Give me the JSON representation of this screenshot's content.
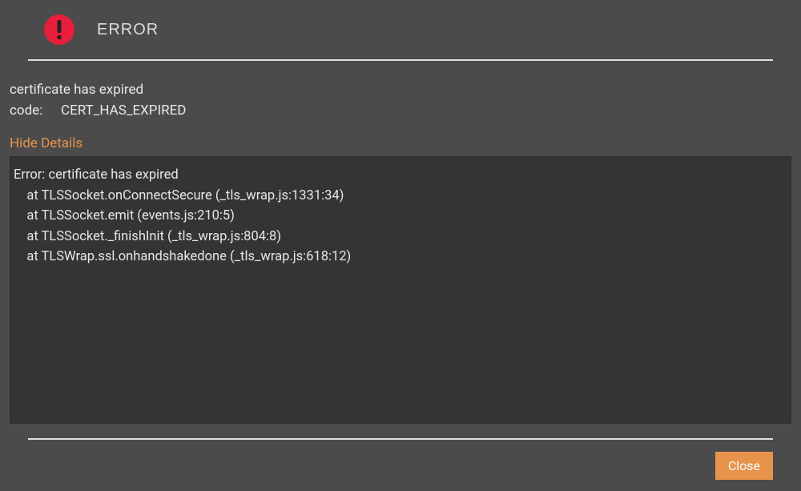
{
  "header": {
    "title": "ERROR",
    "icon_name": "exclamation"
  },
  "message": {
    "text": "certificate has expired",
    "code_label": "code:",
    "code_value": "CERT_HAS_EXPIRED"
  },
  "toggle": {
    "label": "Hide Details"
  },
  "details": {
    "lines": [
      "Error: certificate has expired",
      "    at TLSSocket.onConnectSecure (_tls_wrap.js:1331:34)",
      "    at TLSSocket.emit (events.js:210:5)",
      "    at TLSSocket._finishInit (_tls_wrap.js:804:8)",
      "    at TLSWrap.ssl.onhandshakedone (_tls_wrap.js:618:12)"
    ]
  },
  "footer": {
    "close_label": "Close"
  },
  "colors": {
    "accent": "#e8934a",
    "error": "#e91e3a",
    "background": "#4b4b4b",
    "panel": "#343434"
  }
}
